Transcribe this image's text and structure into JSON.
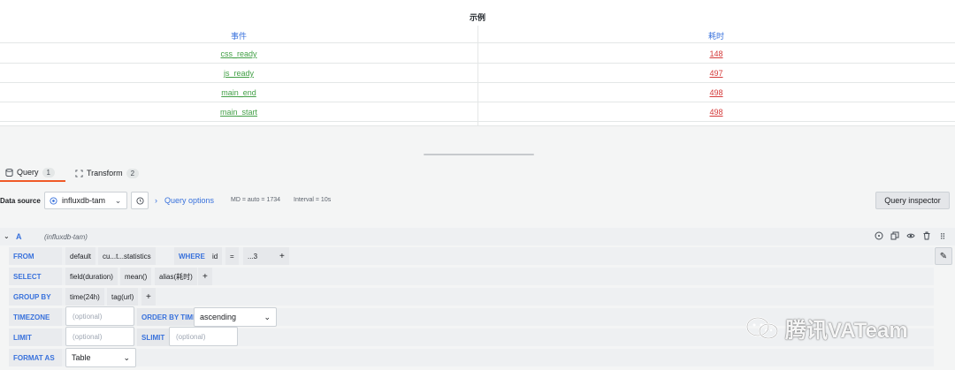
{
  "panel": {
    "title": "示例",
    "columns": [
      "事件",
      "耗时"
    ],
    "rows": [
      {
        "event": "css_ready",
        "duration": "148"
      },
      {
        "event": "js_ready",
        "duration": "497"
      },
      {
        "event": "main_end",
        "duration": "498"
      },
      {
        "event": "main_start",
        "duration": "498"
      }
    ]
  },
  "tabs": [
    {
      "label": "Query",
      "count": "1",
      "icon": "database-icon"
    },
    {
      "label": "Transform",
      "count": "2",
      "icon": "transform-icon"
    }
  ],
  "datasource": {
    "label": "Data source",
    "name": "influxdb-tam",
    "query_options_label": "Query options",
    "md_text": "MD = auto = 1734",
    "interval_text": "Interval = 10s",
    "query_inspector_label": "Query inspector"
  },
  "query": {
    "ref": "A",
    "datasource_name": "(influxdb-tam)",
    "from": {
      "keyword": "FROM",
      "policy": "default",
      "measurement": "cu...t...statistics",
      "where_keyword": "WHERE",
      "tag": "id",
      "op": "=",
      "value": "...3",
      "plus": "+"
    },
    "select": {
      "keyword": "SELECT",
      "parts": [
        "field(duration)",
        "mean()",
        "alias(耗时)"
      ],
      "plus": "+"
    },
    "group_by": {
      "keyword": "GROUP BY",
      "parts": [
        "time(24h)",
        "tag(url)"
      ],
      "plus": "+"
    },
    "timezone": {
      "keyword": "TIMEZONE",
      "placeholder": "(optional)",
      "order_keyword": "ORDER BY TIME",
      "order_value": "ascending"
    },
    "limit": {
      "keyword": "LIMIT",
      "placeholder": "(optional)",
      "slimit_keyword": "SLIMIT",
      "slimit_placeholder": "(optional)"
    },
    "format": {
      "keyword": "FORMAT AS",
      "value": "Table"
    }
  },
  "watermark": {
    "text": "腾讯VATeam",
    "icon": "wechat-logo-icon"
  },
  "colors": {
    "accent": "#3871dc",
    "event_link": "#43a047",
    "duration_link": "#d43a3a",
    "active_tab": "#f05a28"
  }
}
